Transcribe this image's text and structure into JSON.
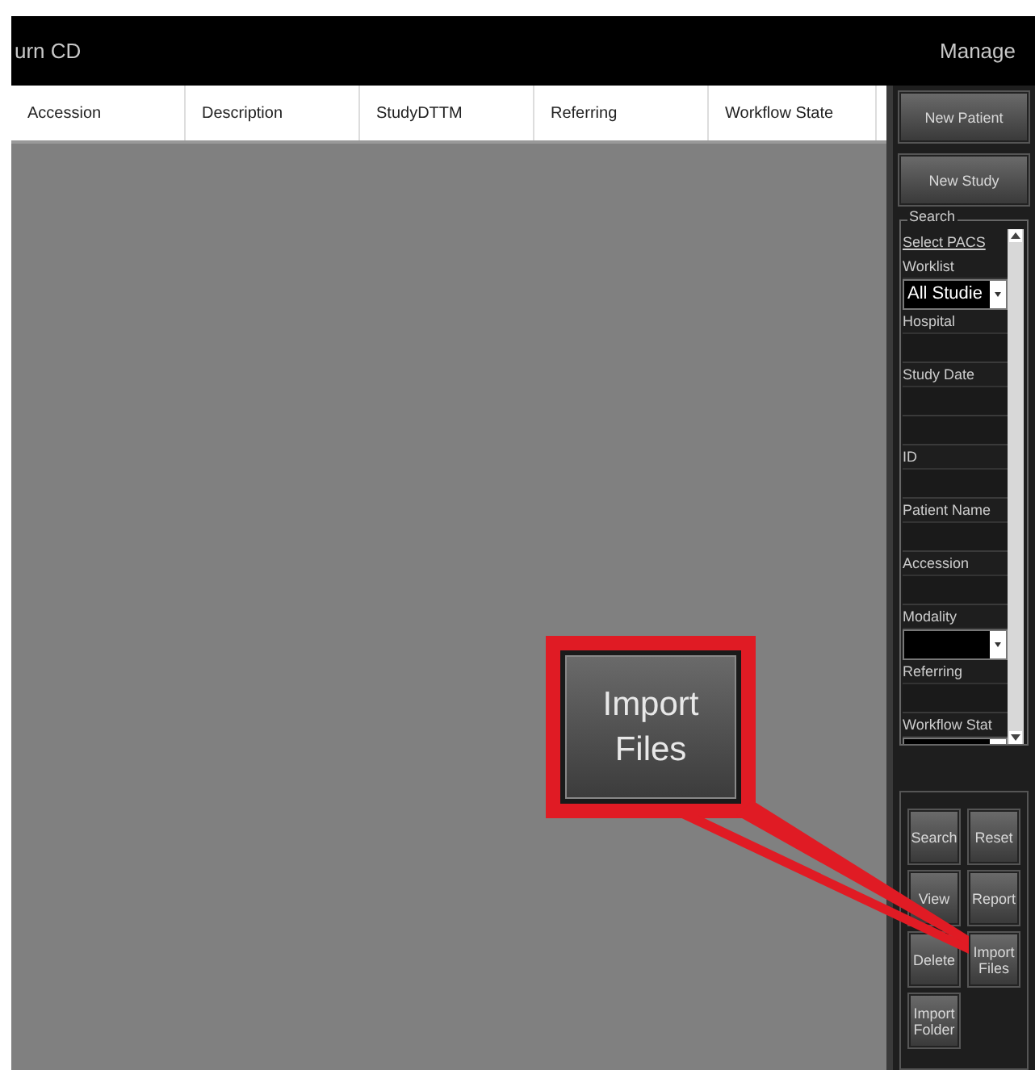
{
  "title_bar": {
    "title": "urn CD",
    "right_label": "Manage"
  },
  "table": {
    "columns": [
      "Accession",
      "Description",
      "StudyDTTM",
      "Referring",
      "Workflow State"
    ]
  },
  "sidebar": {
    "buttons": [
      "New Patient",
      "New Study"
    ],
    "search": {
      "legend": "Search",
      "items": [
        {
          "kind": "link",
          "label": "Select PACS"
        },
        {
          "kind": "label",
          "label": "Worklist"
        },
        {
          "kind": "dropdown",
          "value": "All Studie"
        },
        {
          "kind": "label",
          "label": "Hospital"
        },
        {
          "kind": "field"
        },
        {
          "kind": "label",
          "label": "Study Date"
        },
        {
          "kind": "field"
        },
        {
          "kind": "field"
        },
        {
          "kind": "label",
          "label": "ID"
        },
        {
          "kind": "field"
        },
        {
          "kind": "label",
          "label": "Patient Name"
        },
        {
          "kind": "field"
        },
        {
          "kind": "label",
          "label": "Accession"
        },
        {
          "kind": "field"
        },
        {
          "kind": "label",
          "label": "Modality"
        },
        {
          "kind": "dropdown"
        },
        {
          "kind": "label",
          "label": "Referring"
        },
        {
          "kind": "field"
        },
        {
          "kind": "label",
          "label": "Workflow Stat"
        },
        {
          "kind": "dropdown"
        }
      ]
    },
    "actions": [
      "Search",
      "Reset",
      "View",
      "Report",
      "Delete",
      "Import Files",
      "Import Folder"
    ]
  },
  "callout": {
    "label": "Import Files"
  }
}
